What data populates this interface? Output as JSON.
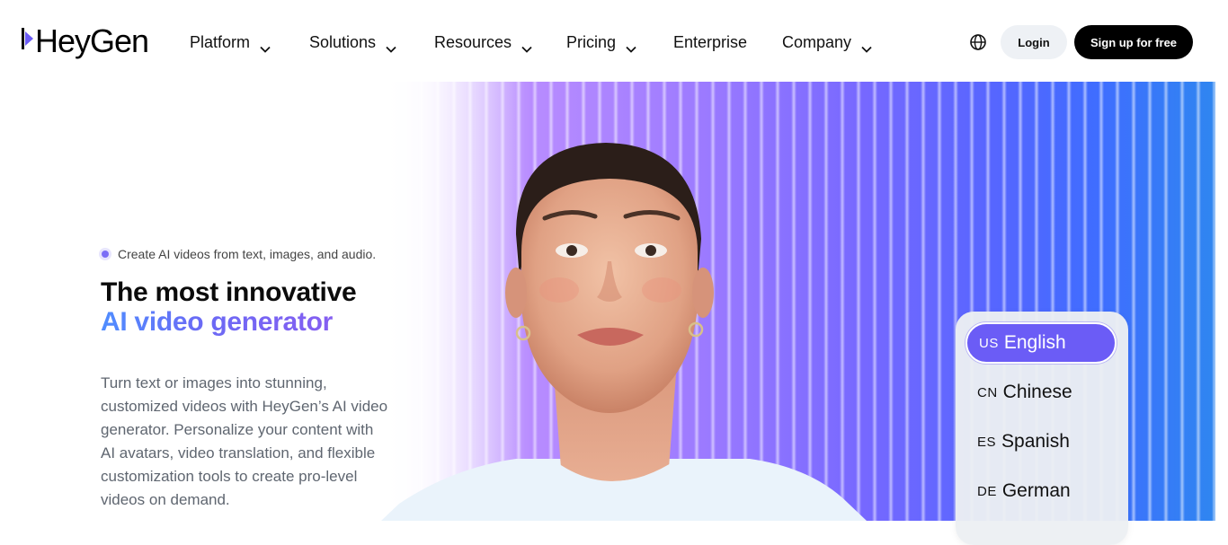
{
  "brand": {
    "name": "HeyGen",
    "accent": "#6b5cf6"
  },
  "nav": {
    "items": [
      {
        "label": "Platform",
        "has_dropdown": true
      },
      {
        "label": "Solutions",
        "has_dropdown": true
      },
      {
        "label": "Resources",
        "has_dropdown": true
      },
      {
        "label": "Pricing",
        "has_dropdown": true
      },
      {
        "label": "Enterprise",
        "has_dropdown": false
      },
      {
        "label": "Company",
        "has_dropdown": true
      }
    ],
    "globe_icon": "globe-icon",
    "login_label": "Login",
    "signup_label": "Sign up for free"
  },
  "hero": {
    "tagline": "Create AI videos from text, images, and audio.",
    "headline_line1": "The most innovative",
    "headline_line2": "AI video generator",
    "description": "Turn text or images into stunning, customized videos with HeyGen’s AI video generator. Personalize your content with AI avatars, video translation, and flexible customization tools to create pro-level videos on demand."
  },
  "languages": {
    "active_index": 0,
    "items": [
      {
        "code": "US",
        "label": "English"
      },
      {
        "code": "CN",
        "label": "Chinese"
      },
      {
        "code": "ES",
        "label": "Spanish"
      },
      {
        "code": "DE",
        "label": "German"
      }
    ]
  }
}
